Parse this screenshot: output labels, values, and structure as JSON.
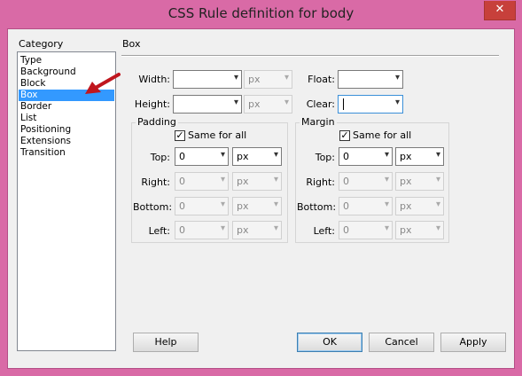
{
  "window": {
    "title": "CSS Rule definition for body",
    "close_label": "✕"
  },
  "category": {
    "label": "Category",
    "items": [
      "Type",
      "Background",
      "Block",
      "Box",
      "Border",
      "List",
      "Positioning",
      "Extensions",
      "Transition"
    ],
    "selected": "Box"
  },
  "section": {
    "title": "Box"
  },
  "box": {
    "width_label": "Width:",
    "height_label": "Height:",
    "float_label": "Float:",
    "clear_label": "Clear:",
    "unit_placeholder": "px"
  },
  "padding": {
    "title": "Padding",
    "same_for_all": "Same for all",
    "top_label": "Top:",
    "right_label": "Right:",
    "bottom_label": "Bottom:",
    "left_label": "Left:",
    "top_value": "0",
    "right_value": "0",
    "bottom_value": "0",
    "left_value": "0",
    "unit": "px"
  },
  "margin": {
    "title": "Margin",
    "same_for_all": "Same for all",
    "top_label": "Top:",
    "right_label": "Right:",
    "bottom_label": "Bottom:",
    "left_label": "Left:",
    "top_value": "0",
    "right_value": "0",
    "bottom_value": "0",
    "left_value": "0",
    "unit": "px"
  },
  "buttons": {
    "help": "Help",
    "ok": "OK",
    "cancel": "Cancel",
    "apply": "Apply"
  },
  "icons": {
    "dropdown": "▾",
    "check": "✓"
  },
  "colors": {
    "frame": "#d96aa6",
    "selection": "#3399ff",
    "arrow": "#c0161e"
  }
}
